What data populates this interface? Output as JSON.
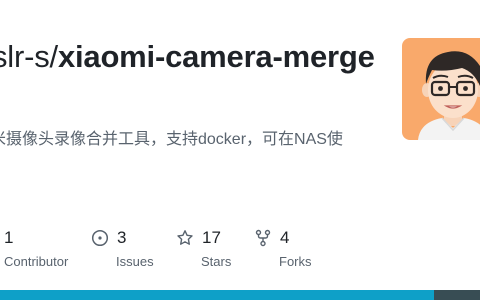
{
  "repo": {
    "owner_prefix": "slr-s/",
    "name": "xiaomi-camera-merge",
    "description": "米摄像头录像合并工具，支持docker，可在NAS使"
  },
  "stats": [
    {
      "count": "1",
      "label": "Contributor",
      "icon": "people-icon"
    },
    {
      "count": "3",
      "label": "Issues",
      "icon": "issue-icon"
    },
    {
      "count": "17",
      "label": "Stars",
      "icon": "star-icon"
    },
    {
      "count": "4",
      "label": "Forks",
      "icon": "fork-icon"
    }
  ],
  "languages": [
    {
      "color": "#0ea0c8",
      "fraction": 0.905
    },
    {
      "color": "#384d54",
      "fraction": 0.095
    }
  ],
  "colors": {
    "avatar_bg": "#f9a96b",
    "text_primary": "#1f2328",
    "text_muted": "#59636e"
  }
}
